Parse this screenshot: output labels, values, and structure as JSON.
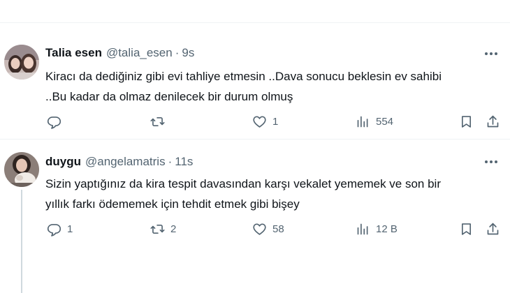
{
  "tweets": [
    {
      "name": "Talia esen",
      "handle": "@talia_esen",
      "separator": "·",
      "time": "9s",
      "lines": [
        "Kiracı da dediğiniz gibi evi tahliye etmesin ..Dava sonucu beklesin ev sahibi",
        "..Bu kadar da olmaz denilecek bir durum olmuş"
      ],
      "replies": "",
      "retweets": "",
      "likes": "1",
      "views": "554"
    },
    {
      "name": "duygu",
      "handle": "@angelamatris",
      "separator": "·",
      "time": "11s",
      "lines": [
        "Sizin yaptığınız da kira tespit davasından karşı vekalet yememek ve son bir",
        "yıllık farkı ödememek için tehdit etmek gibi bişey"
      ],
      "replies": "1",
      "retweets": "2",
      "likes": "58",
      "views": "12 B"
    }
  ],
  "icons": {
    "reply": "reply-icon",
    "retweet": "retweet-icon",
    "like": "heart-icon",
    "views": "views-icon",
    "bookmark": "bookmark-icon",
    "share": "share-icon",
    "more": "more-icon"
  },
  "colors": {
    "text": "#0f1419",
    "secondary": "#536471",
    "border": "#eff3f4",
    "thread_line": "#cfd9de"
  }
}
